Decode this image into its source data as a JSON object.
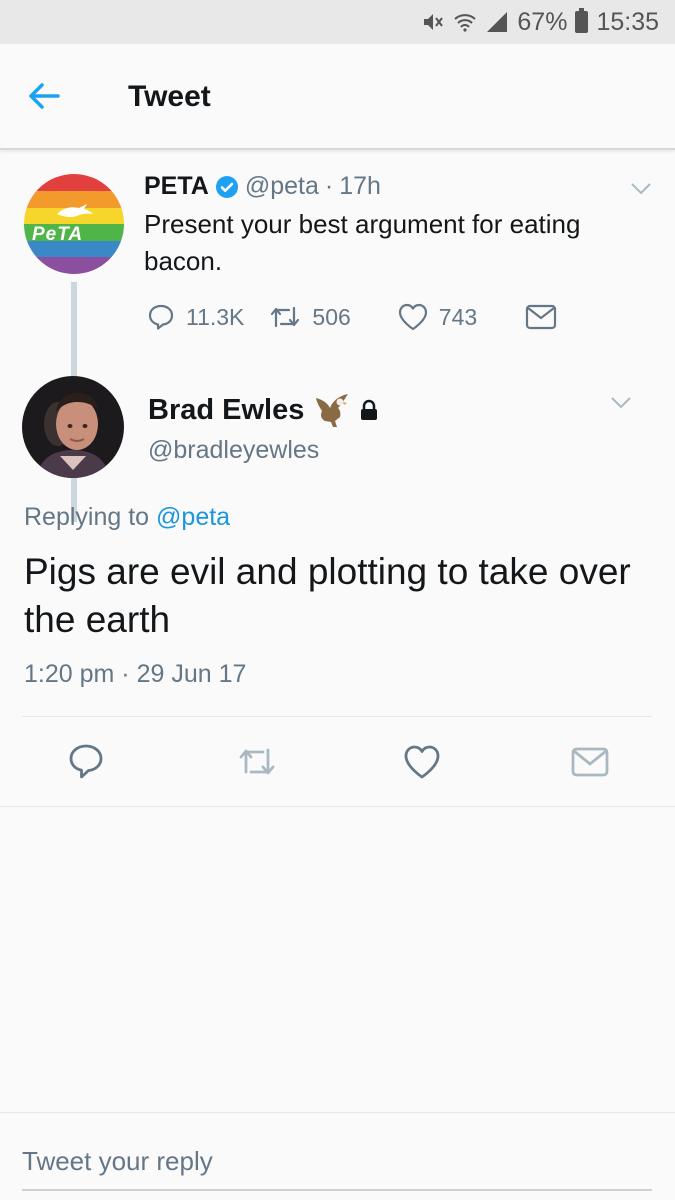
{
  "status_bar": {
    "battery": "67%",
    "time": "15:35",
    "icons": [
      "mute-icon",
      "wifi-icon",
      "signal-icon",
      "battery-icon"
    ]
  },
  "header": {
    "title": "Tweet",
    "back_icon": "back-arrow-icon"
  },
  "original_tweet": {
    "author_name": "PETA",
    "verified": true,
    "handle": "@peta",
    "separator": "·",
    "time_ago": "17h",
    "text": "Present your best argument for eating bacon.",
    "avatar_text": "PeTA",
    "actions": {
      "replies": "11.3K",
      "retweets": "506",
      "likes": "743"
    }
  },
  "reply_tweet": {
    "author_name": "Brad Ewles",
    "handle": "@bradleyewles",
    "locked": true,
    "replying_prefix": "Replying to",
    "replying_to": "@peta",
    "text": "Pigs are evil and plotting to take over the earth",
    "time": "1:20 pm",
    "separator": "·",
    "date": "29 Jun 17"
  },
  "compose": {
    "placeholder": "Tweet your reply"
  },
  "colors": {
    "accent": "#1da1f2",
    "link": "#1b95e0",
    "muted": "#657786",
    "text": "#14171a"
  }
}
